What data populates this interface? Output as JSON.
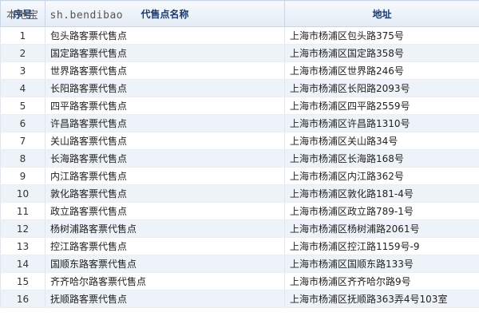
{
  "watermark": {
    "name": "本地宝",
    "domain": "sh.bendibao"
  },
  "headers": {
    "index": "序号",
    "name": "代售点名称",
    "address": "地址"
  },
  "rows": [
    {
      "index": "1",
      "name": "包头路客票代售点",
      "address": "上海市杨浦区包头路375号"
    },
    {
      "index": "2",
      "name": "国定路客票代售点",
      "address": "上海市杨浦区国定路358号"
    },
    {
      "index": "3",
      "name": "世界路客票代售点",
      "address": "上海市杨浦区世界路246号"
    },
    {
      "index": "4",
      "name": "长阳路客票代售点",
      "address": "上海市杨浦区长阳路2093号"
    },
    {
      "index": "5",
      "name": "四平路客票代售点",
      "address": "上海市杨浦区四平路2559号"
    },
    {
      "index": "6",
      "name": "许昌路客票代售点",
      "address": "上海市杨浦区许昌路1310号"
    },
    {
      "index": "7",
      "name": "关山路客票代售点",
      "address": "上海市杨浦区关山路34号"
    },
    {
      "index": "8",
      "name": "长海路客票代售点",
      "address": "上海市杨浦区长海路168号"
    },
    {
      "index": "9",
      "name": "内江路客票代售点",
      "address": "上海市杨浦区内江路362号"
    },
    {
      "index": "10",
      "name": "敦化路客票代售点",
      "address": "上海市杨浦区敦化路181-4号"
    },
    {
      "index": "11",
      "name": "政立路客票代售点",
      "address": "上海市杨浦区政立路789-1号"
    },
    {
      "index": "12",
      "name": "杨树浦路客票代售点",
      "address": "上海市杨浦区杨树浦路2061号"
    },
    {
      "index": "13",
      "name": "控江路客票代售点",
      "address": "上海市杨浦区控江路1159号-9"
    },
    {
      "index": "14",
      "name": "国顺东路客票代售点",
      "address": "上海市杨浦区国顺东路133号"
    },
    {
      "index": "15",
      "name": "齐齐哈尔路客票代售点",
      "address": "上海市杨浦区齐齐哈尔路9号"
    },
    {
      "index": "16",
      "name": "抚顺路客票代售点",
      "address": "上海市杨浦区抚顺路363弄4号103室"
    }
  ]
}
